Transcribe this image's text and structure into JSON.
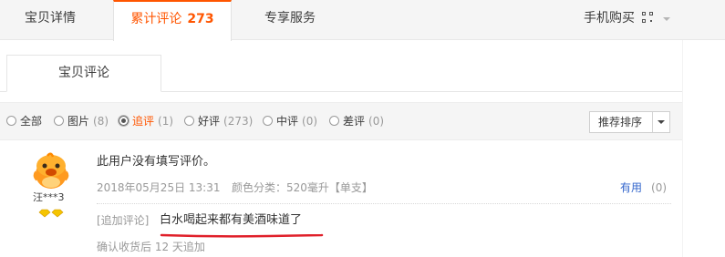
{
  "tabs": {
    "details": "宝贝详情",
    "reviews_label": "累计评论",
    "reviews_count": "273",
    "exclusive": "专享服务",
    "mobile": "手机购买"
  },
  "subtab": {
    "label": "宝贝评论"
  },
  "filters": [
    {
      "label": "全部",
      "count": "",
      "checked": false
    },
    {
      "label": "图片",
      "count": "(8)",
      "checked": false
    },
    {
      "label": "追评",
      "count": "(1)",
      "checked": true
    },
    {
      "label": "好评",
      "count": "(273)",
      "checked": false
    },
    {
      "label": "中评",
      "count": "(0)",
      "checked": false
    },
    {
      "label": "差评",
      "count": "(0)",
      "checked": false
    }
  ],
  "sort": {
    "label": "推荐排序"
  },
  "review": {
    "username": "汪***3",
    "text": "此用户没有填写评价。",
    "date": "2018年05月25日 13:31",
    "sku": "颜色分类：520毫升【单支】",
    "useful_label": "有用",
    "useful_count": "(0)",
    "append_label": "[追加评论]",
    "append_text": "白水喝起来都有美酒味道了",
    "append_time": "确认收货后 12 天追加"
  },
  "colors": {
    "accent": "#ff5500",
    "link": "#3366cc",
    "muted": "#999999",
    "underline": "#e0202a"
  },
  "icons": {
    "qr": "qr-code-icon",
    "chevron": "chevron-down-icon",
    "avatar": "orange-mascot-avatar",
    "badge": "vip-diamond-icon"
  }
}
